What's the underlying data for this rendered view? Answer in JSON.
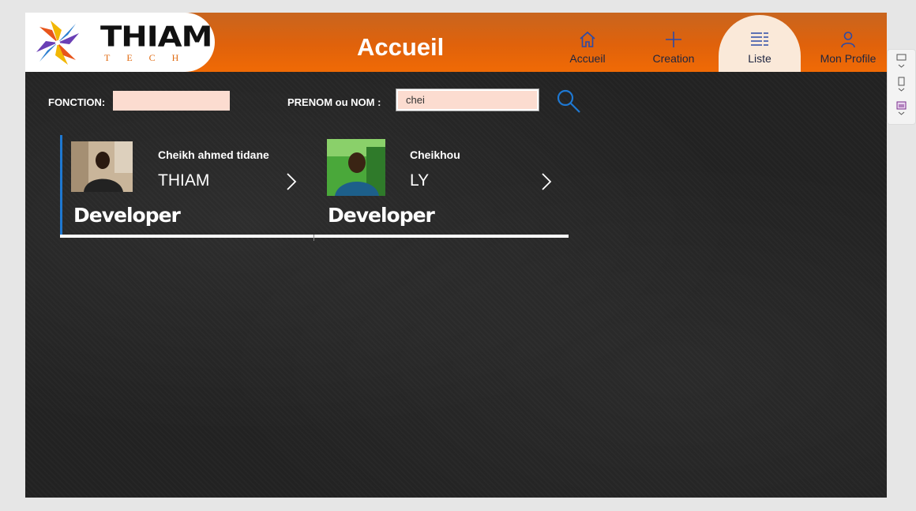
{
  "header": {
    "brand_name": "THIAM",
    "brand_sub": "TECH",
    "page_title": "Accueil",
    "nav": [
      {
        "label": "Accueil",
        "icon": "home-icon"
      },
      {
        "label": "Creation",
        "icon": "plus-icon"
      },
      {
        "label": "Liste",
        "icon": "list-icon",
        "selected": true
      },
      {
        "label": "Mon Profile",
        "icon": "user-icon"
      }
    ]
  },
  "filters": {
    "fonction_label": "FONCTION:",
    "fonction_value": "",
    "prenom_label": "PRENOM ou NOM :",
    "prenom_value": "chei"
  },
  "cards": [
    {
      "firstname": "Cheikh ahmed tidane",
      "lastname": "THIAM",
      "role": "Developer",
      "selected": true
    },
    {
      "firstname": "Cheikhou",
      "lastname": "LY",
      "role": "Developer",
      "selected": false
    }
  ],
  "colors": {
    "header_orange": "#f06a05",
    "selected_nav_bg": "#fae9d9",
    "input_bg": "#fcdcd0",
    "selection_blue": "#1e78d2"
  }
}
